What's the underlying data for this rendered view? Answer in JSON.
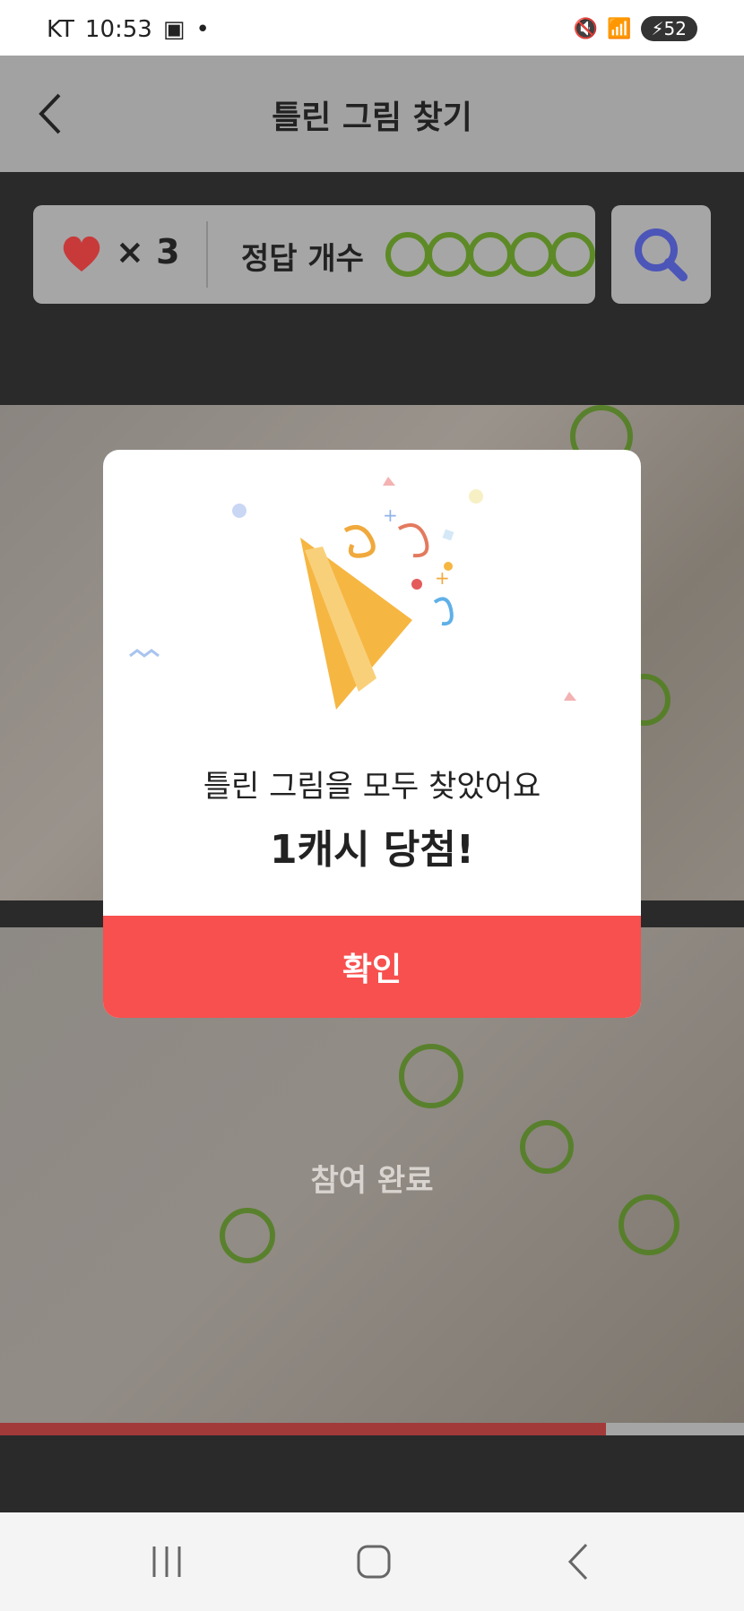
{
  "status_bar": {
    "carrier": "KT",
    "time": "10:53",
    "battery": "52"
  },
  "header": {
    "title": "틀린 그림 찾기"
  },
  "score": {
    "lives": "× 3",
    "answer_label": "정답 개수",
    "answers_found": 5,
    "answers_total": 5
  },
  "game": {
    "status_text": "참여 완료",
    "progress_fraction": 0.815
  },
  "modal": {
    "message": "틀린 그림을 모두 찾았어요",
    "prize": "1캐시 당첨!",
    "confirm_label": "확인"
  },
  "colors": {
    "accent": "#f7504e",
    "ring": "#5d8a26",
    "heart": "#c83a3a",
    "search": "#4c55b8"
  }
}
